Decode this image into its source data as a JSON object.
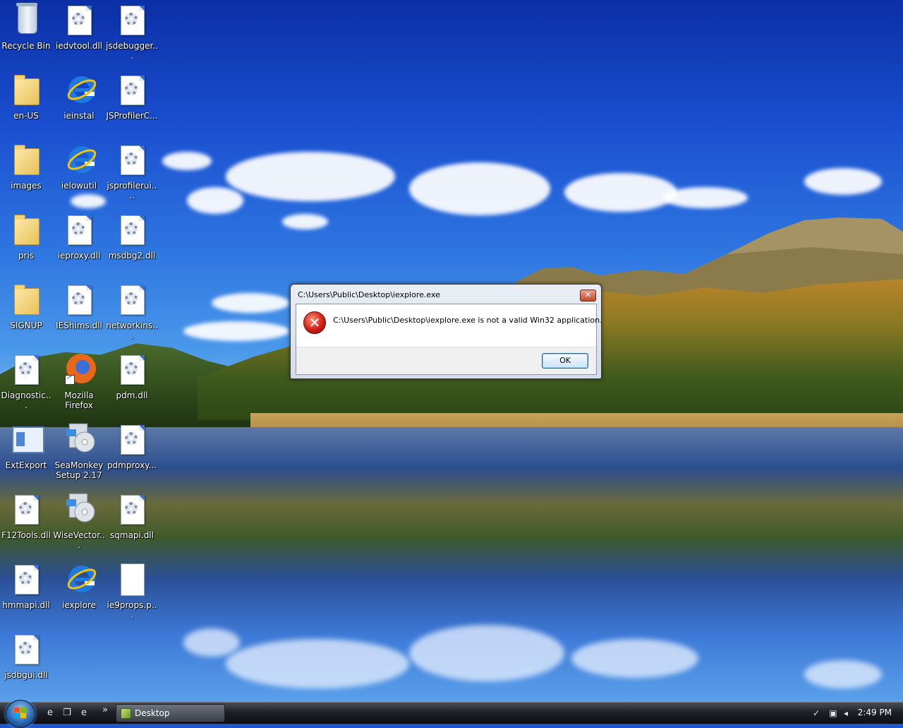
{
  "desktop": {
    "icons": [
      {
        "label": "Recycle Bin",
        "icon": "recycle-bin-icon"
      },
      {
        "label": "iedvtool.dll",
        "icon": "dll-file-icon"
      },
      {
        "label": "jsdebugger...",
        "icon": "dll-file-icon"
      },
      {
        "label": "en-US",
        "icon": "folder-icon"
      },
      {
        "label": "ieinstal",
        "icon": "internet-explorer-icon"
      },
      {
        "label": "JSProfilerC...",
        "icon": "dll-file-icon"
      },
      {
        "label": "images",
        "icon": "folder-icon"
      },
      {
        "label": "ielowutil",
        "icon": "internet-explorer-icon"
      },
      {
        "label": "jsprofilerui....",
        "icon": "dll-file-icon"
      },
      {
        "label": "pris",
        "icon": "folder-icon"
      },
      {
        "label": "ieproxy.dll",
        "icon": "dll-file-icon"
      },
      {
        "label": "msdbg2.dll",
        "icon": "dll-file-icon"
      },
      {
        "label": "SIGNUP",
        "icon": "folder-icon"
      },
      {
        "label": "IEShims.dll",
        "icon": "dll-file-icon"
      },
      {
        "label": "networkins...",
        "icon": "dll-file-icon"
      },
      {
        "label": "Diagnostic...",
        "icon": "dll-file-icon"
      },
      {
        "label": "Mozilla Firefox",
        "icon": "firefox-icon"
      },
      {
        "label": "pdm.dll",
        "icon": "dll-file-icon"
      },
      {
        "label": "ExtExport",
        "icon": "application-icon"
      },
      {
        "label": "SeaMonkey Setup 2.17",
        "icon": "setup-icon"
      },
      {
        "label": "pdmproxy...",
        "icon": "dll-file-icon"
      },
      {
        "label": "F12Tools.dll",
        "icon": "dll-file-icon"
      },
      {
        "label": "WiseVector...",
        "icon": "setup-icon"
      },
      {
        "label": "sqmapi.dll",
        "icon": "dll-file-icon"
      },
      {
        "label": "hmmapi.dll",
        "icon": "dll-file-icon"
      },
      {
        "label": "iexplore",
        "icon": "internet-explorer-icon"
      },
      {
        "label": "ie9props.p...",
        "icon": "blank-file-icon"
      },
      {
        "label": "jsdbgui.dll",
        "icon": "dll-file-icon"
      }
    ]
  },
  "dialog": {
    "title": "C:\\Users\\Public\\Desktop\\iexplore.exe",
    "close_label": "✕",
    "message": "C:\\Users\\Public\\Desktop\\iexplore.exe is not a valid Win32 application.",
    "ok_label": "OK",
    "icon": "error-icon"
  },
  "taskbar": {
    "start_icon": "windows-start-icon",
    "quick_launch": [
      "internet-explorer-icon",
      "switch-windows-icon",
      "internet-explorer-icon"
    ],
    "overflow": "»",
    "task_label": "Desktop",
    "clock": "2:49 PM",
    "tray_icons": [
      "safely-remove-icon",
      "network-icon",
      "volume-icon"
    ]
  },
  "colors": {
    "accent": "#2b6bb6",
    "error": "#d21f14",
    "taskbar": "#1d2127"
  }
}
